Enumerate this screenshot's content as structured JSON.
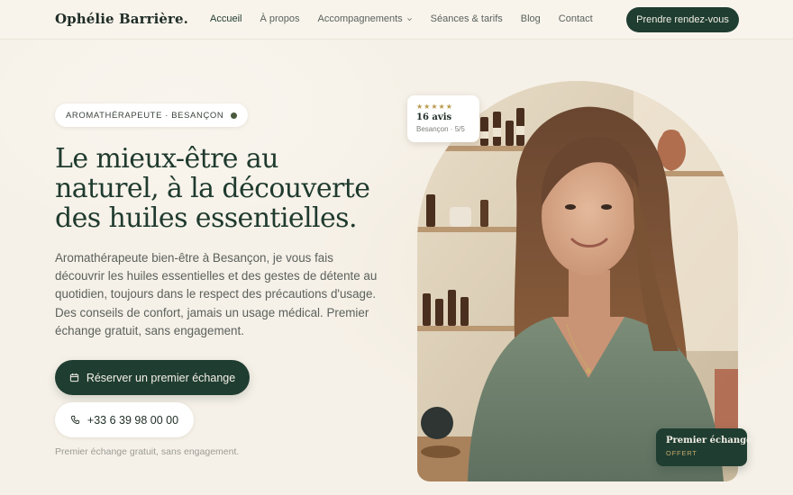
{
  "brand": {
    "name": "Ophélie Barrière."
  },
  "nav": {
    "items": [
      {
        "label": "Accueil"
      },
      {
        "label": "À propos"
      },
      {
        "label": "Accompagnements"
      },
      {
        "label": "Séances & tarifs"
      },
      {
        "label": "Blog"
      },
      {
        "label": "Contact"
      }
    ],
    "cta_label": "Prendre rendez-vous"
  },
  "hero": {
    "badge": "AROMATHÉRAPEUTE · BESANÇON",
    "title": "Le mieux-être au naturel, à la découverte des huiles essentielles.",
    "lead": "Aromathérapeute bien-être à Besançon, je vous fais découvrir les huiles essentielles et des gestes de détente au quotidien, toujours dans le respect des précautions d'usage. Des conseils de confort, jamais un usage médical. Premier échange gratuit, sans engagement.",
    "primary_button": "Réserver un premier échange",
    "phone_button": "+33 6 39 98 00 00",
    "note": "Premier échange gratuit, sans engagement."
  },
  "review": {
    "stars": "★★★★★",
    "count": "16 avis",
    "meta": "Besançon · 5/5"
  },
  "offer": {
    "title": "Premier échange",
    "subtitle": "OFFERT"
  },
  "colors": {
    "accent": "#1f3d31",
    "background": "#f6f1e8",
    "gold": "#b99a4b"
  },
  "icons": {
    "primary_button": "calendar-icon",
    "phone_button": "phone-icon",
    "dropdown": "chevron-down-icon"
  }
}
